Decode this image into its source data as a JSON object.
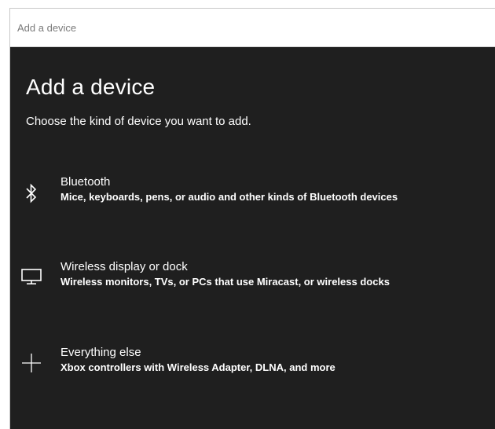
{
  "window": {
    "title": "Add a device"
  },
  "main": {
    "heading": "Add a device",
    "subtitle": "Choose the kind of device you want to add."
  },
  "options": [
    {
      "icon": "bluetooth-icon",
      "title": "Bluetooth",
      "description": "Mice, keyboards, pens, or audio and other kinds of Bluetooth devices"
    },
    {
      "icon": "monitor-icon",
      "title": "Wireless display or dock",
      "description": "Wireless monitors, TVs, or PCs that use Miracast, or wireless docks"
    },
    {
      "icon": "plus-icon",
      "title": "Everything else",
      "description": "Xbox controllers with Wireless Adapter, DLNA, and more"
    }
  ],
  "colors": {
    "background": "#1f1f1f",
    "titlebar": "#ffffff",
    "titlebar_text": "#7a7a7a",
    "text": "#ffffff"
  }
}
